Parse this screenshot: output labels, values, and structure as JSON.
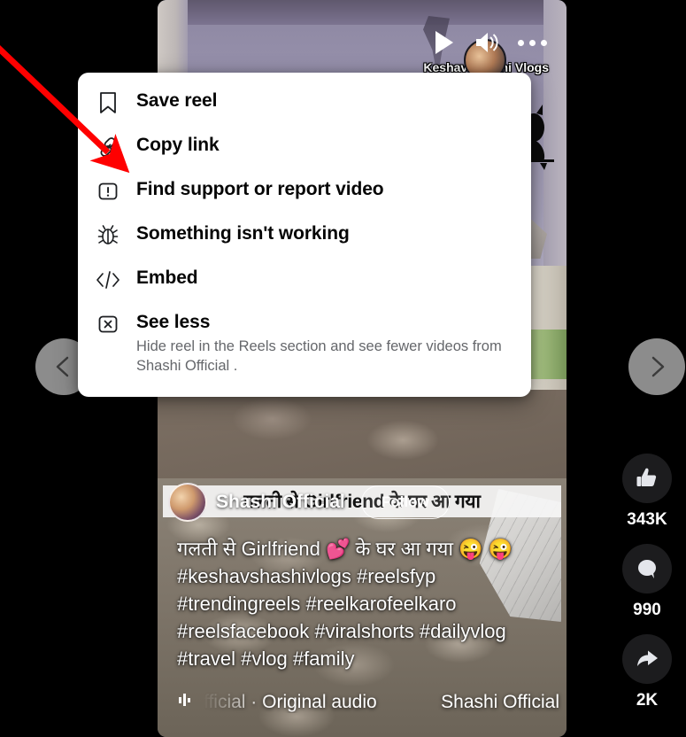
{
  "video": {
    "watermark": "Keshav Shashi Vlogs",
    "controls": {
      "play": "play-button",
      "volume": "volume-button",
      "more": "more-options-button"
    },
    "burned_in_subtitle": "गलती से Girlfriend के घर आ गया",
    "profile": {
      "name": "Shashi Official",
      "follow_label": "Follow"
    },
    "caption": {
      "line1": "गलती से Girlfriend 💕 के घर आ गया  😜 😜",
      "line2": "#keshavshashivlogs #reelsfyp",
      "line3": "#trendingreels #reelkarofeelkaro",
      "line4": "#reelsfacebook #viralshorts #dailyvlog",
      "line5": "#travel #vlog #family"
    },
    "audio": {
      "title": "fficial · Original audio",
      "author": "Shashi Official"
    }
  },
  "nav": {
    "prev_label": "previous-reel",
    "next_label": "next-reel"
  },
  "actions": [
    {
      "icon": "thumbs-up-icon",
      "name": "like-button",
      "count": "343K"
    },
    {
      "icon": "comment-icon",
      "name": "comment-button",
      "count": "990"
    },
    {
      "icon": "share-icon",
      "name": "share-button",
      "count": "2K"
    }
  ],
  "menu": {
    "items": [
      {
        "icon": "bookmark-icon",
        "label": "Save reel",
        "sub": ""
      },
      {
        "icon": "link-icon",
        "label": "Copy link",
        "sub": ""
      },
      {
        "icon": "report-icon",
        "label": "Find support or report video",
        "sub": ""
      },
      {
        "icon": "bug-icon",
        "label": "Something isn't working",
        "sub": ""
      },
      {
        "icon": "code-icon",
        "label": "Embed",
        "sub": ""
      },
      {
        "icon": "see-less-icon",
        "label": "See less",
        "sub": "Hide reel in the Reels section and see fewer videos from Shashi Official ."
      }
    ]
  },
  "annotation": {
    "arrow_color": "#FF0000",
    "points_to": "Copy link"
  },
  "colors": {
    "background": "#000000",
    "menu_background": "#FFFFFF",
    "menu_label": "#050505",
    "menu_subtext": "#65676B",
    "rail_button": "#1C1C1E",
    "accent_red": "#FF0000"
  }
}
